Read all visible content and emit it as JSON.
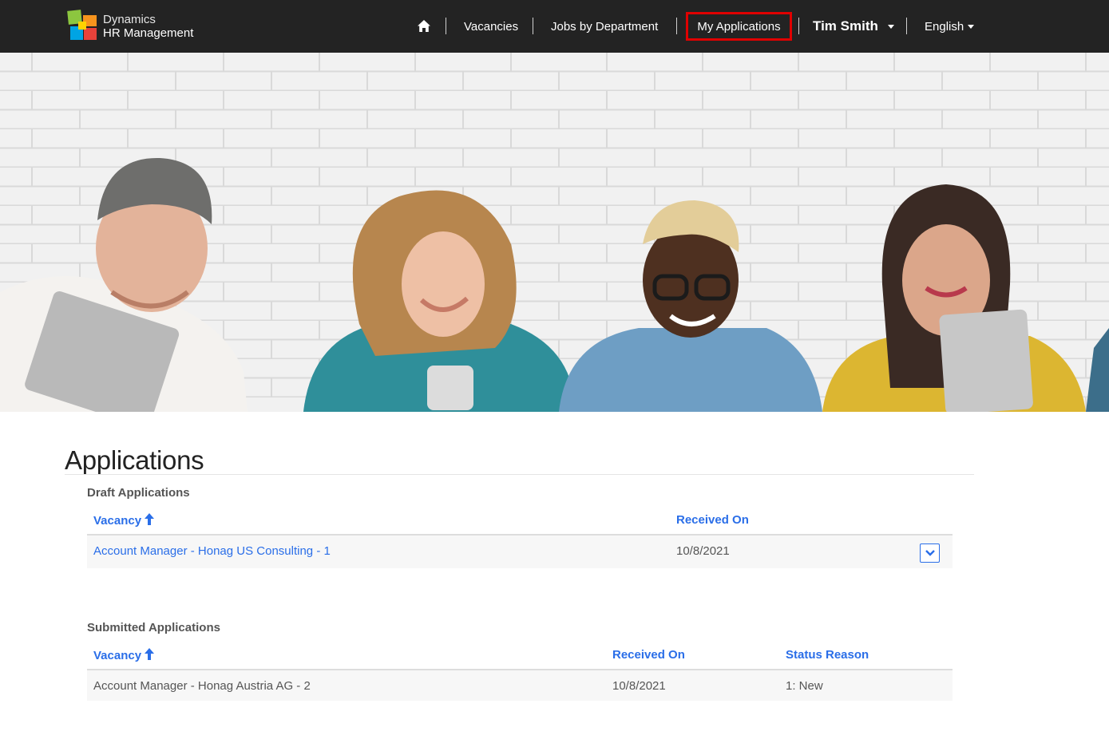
{
  "brand": {
    "line1": "Dynamics",
    "line2": "HR Management"
  },
  "nav": {
    "home_icon": "home-icon",
    "vacancies": "Vacancies",
    "jobs_by_department": "Jobs by Department",
    "my_applications": "My Applications",
    "user": "Tim Smith",
    "language": "English"
  },
  "colors": {
    "navbar": "#232323",
    "link": "#2a6ee8",
    "highlight": "#e00000"
  },
  "page": {
    "title": "Applications"
  },
  "draft": {
    "title": "Draft Applications",
    "columns": {
      "vacancy": "Vacancy",
      "received_on": "Received On"
    },
    "rows": [
      {
        "vacancy": "Account Manager - Honag US Consulting - 1",
        "received_on": "10/8/2021",
        "action_icon": "chevron-down-icon"
      }
    ]
  },
  "submitted": {
    "title": "Submitted Applications",
    "columns": {
      "vacancy": "Vacancy",
      "received_on": "Received On",
      "status_reason": "Status Reason"
    },
    "rows": [
      {
        "vacancy": "Account Manager - Honag Austria AG - 2",
        "received_on": "10/8/2021",
        "status_reason": "1: New"
      }
    ]
  }
}
